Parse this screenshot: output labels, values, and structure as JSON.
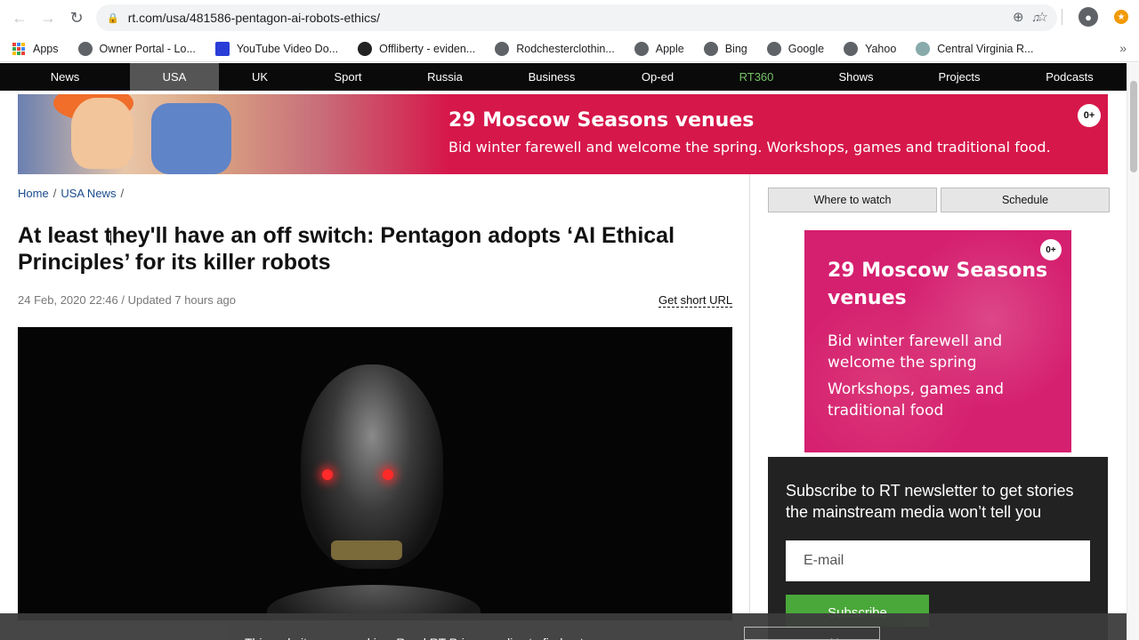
{
  "browser": {
    "url": "rt.com/usa/481586-pentagon-ai-robots-ethics/",
    "bookmarks": [
      "Apps",
      "Owner Portal - Lo...",
      "YouTube Video Do...",
      "Offliberty - eviden...",
      "Rodchesterclothin...",
      "Apple",
      "Bing",
      "Google",
      "Yahoo",
      "Central Virginia R..."
    ]
  },
  "nav": {
    "items": [
      "News",
      "USA",
      "UK",
      "Sport",
      "Russia",
      "Business",
      "Op-ed",
      "RT360",
      "Shows",
      "Projects",
      "Podcasts"
    ],
    "active": "USA"
  },
  "banner": {
    "title": "29 Moscow Seasons venues",
    "subtitle": "Bid winter farewell and welcome the spring. Workshops, games and traditional food.",
    "age": "0+"
  },
  "breadcrumb": {
    "home": "Home",
    "section": "USA News",
    "sep": "/"
  },
  "article": {
    "headline": "At least they'll have an off switch: Pentagon adopts ‘AI Ethical Principles’ for its killer robots",
    "dateline": "24 Feb, 2020 22:46 / Updated 7 hours ago",
    "short_url": "Get short URL"
  },
  "sidebar": {
    "where_to_watch": "Where to watch",
    "schedule": "Schedule",
    "ad": {
      "title": "29 Moscow Seasons venues",
      "line1": "Bid winter farewell and welcome the spring",
      "line2": "Workshops, games and traditional food",
      "age": "0+"
    },
    "newsletter": {
      "title": "Subscribe to RT newsletter to get stories the mainstream media won’t tell you",
      "placeholder": "E-mail",
      "button": "Subscribe"
    }
  },
  "cookie": {
    "text": "This website uses cookies. Read RT Privacy policy to find out more.",
    "button": "Accept cookies"
  }
}
